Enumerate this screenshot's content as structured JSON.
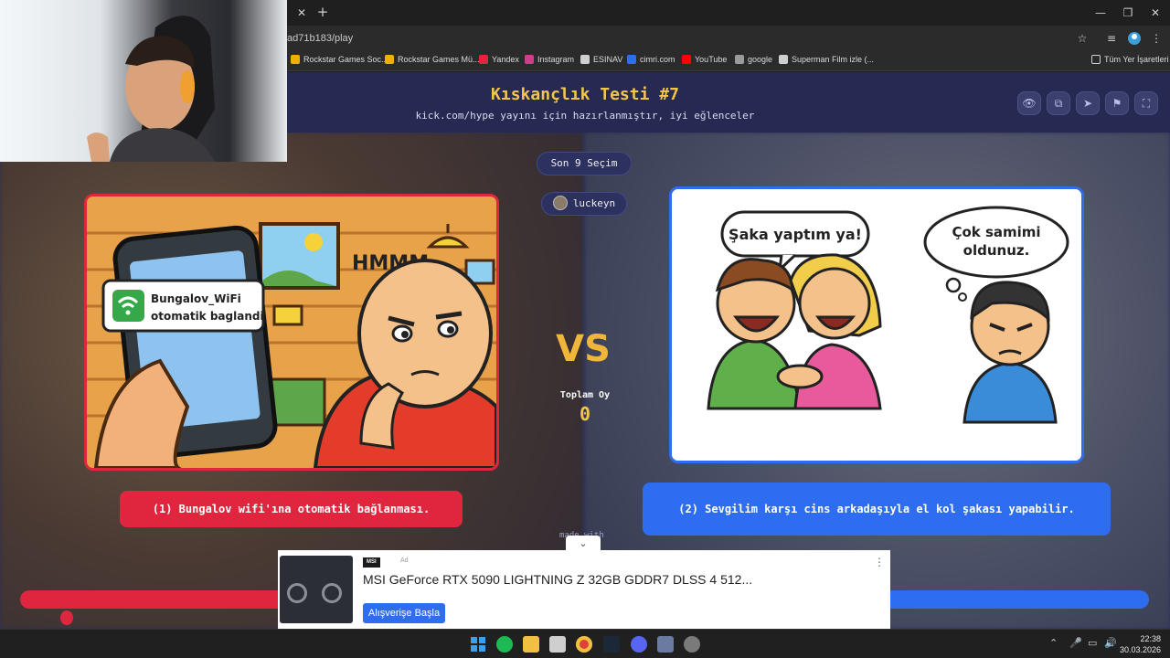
{
  "browser": {
    "url": "ad71b183/play",
    "bookmarks": [
      {
        "label": "Rockstar Games Soc...",
        "color": "#f0b000"
      },
      {
        "label": "Rockstar Games Mü...",
        "color": "#f0b000"
      },
      {
        "label": "Yandex",
        "color": "#e0263f"
      },
      {
        "label": "Instagram",
        "color": "#d23c8a"
      },
      {
        "label": "ESINAV",
        "color": "#cfcfcf"
      },
      {
        "label": "cimri.com",
        "color": "#2f6df0"
      },
      {
        "label": "YouTube",
        "color": "#ff0000"
      },
      {
        "label": "google",
        "color": "#9a9a9a"
      },
      {
        "label": "Superman Film izle (...",
        "color": "#cfcfcf"
      }
    ],
    "all_bookmarks": "Tüm Yer İşaretleri"
  },
  "header": {
    "title": "Kıskançlık Testi #7",
    "subtitle": "kick.com/hype yayını için hazırlanmıştır, iyi eğlenceler",
    "buttons": [
      "eye-icon",
      "copy-icon",
      "send-icon",
      "flag-icon",
      "fullscreen-icon"
    ]
  },
  "status": {
    "round": "Son 9 Seçim",
    "user": "luckeyn"
  },
  "left_card": {
    "bubble_line1": "Bungalov_WiFi",
    "bubble_line2": "otomatik baglandi",
    "thought": "HMMM...",
    "option": "(1) Bungalov wifi'ına otomatik bağlanması."
  },
  "right_card": {
    "speech": "Şaka yaptım ya!",
    "thought_line1": "Çok samimi",
    "thought_line2": "oldunuz.",
    "option": "(2) Sevgilim karşı cins arkadaşıyla el kol şakası yapabilir."
  },
  "center": {
    "vs": "VS",
    "total_label": "Toplam Oy",
    "total_value": "0"
  },
  "made_with": "made with",
  "ad": {
    "brand": "MSI",
    "tag": "Ad",
    "title": "MSI GeForce RTX 5090 LIGHTNING Z 32GB GDDR7 DLSS 4 512...",
    "cta": "Alışverişe Başla"
  },
  "taskbar": {
    "time": "22:38",
    "date": "30.03.2026"
  },
  "colors": {
    "accent_red": "#e0263f",
    "accent_blue": "#2f6df0",
    "title_gold": "#f3c64a"
  }
}
